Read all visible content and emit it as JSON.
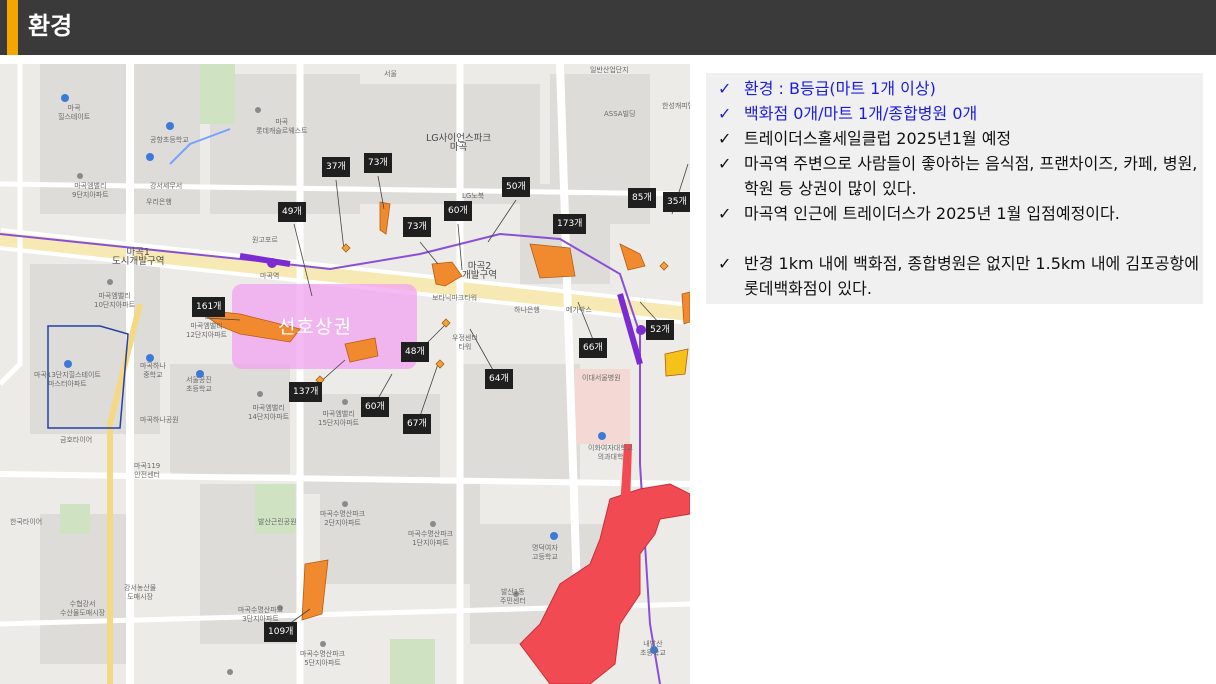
{
  "header": {
    "title": "환경",
    "accent_color": "#f5a500",
    "bar_color": "#3a3a3a"
  },
  "map": {
    "zone_label": "선호상권",
    "counts": {
      "c37": "37개",
      "c73a": "73개",
      "c49": "49개",
      "c60a": "60개",
      "c73b": "73개",
      "c50": "50개",
      "c173": "173개",
      "c85": "85개",
      "c35": "35개",
      "c161": "161개",
      "c48": "48개",
      "c52": "52개",
      "c66": "66개",
      "c137": "137개",
      "c60b": "60개",
      "c64": "64개",
      "c67": "67개",
      "c109": "109개"
    },
    "labels": {
      "ilsan": "일반산업단지",
      "seoul": "서울",
      "mg_hills": "마곡\n힐스테이트",
      "lotte_castle": "마곡\n롯데캐슬르웨스트",
      "lg_science": "LG사이언스파크\n마곡",
      "gonghang_school": "공항초등학교",
      "mg_valley9": "마곡엠밸리\n9단지아파트",
      "gangseo_tax": "강서세무서",
      "woori_bank": "우리은행",
      "woonji_school": "원고포르",
      "magok1": "마곡1\n도시개발구역",
      "mg_valley10": "마곡엠밸리\n10단지아파트",
      "magok2": "마곡2\n개발구역",
      "botanic": "보타닉파크타워",
      "hana_bank": "하나은행",
      "megabox": "메가박스",
      "ewha_hosp": "이대서울병원",
      "mg_valley12": "마곡엠밸리\n12단지아파트",
      "magok_stn": "마곡역",
      "mg13": "마곡13단지힐스테이트\n마스터아파트",
      "mg_middle": "마곡하나\n중학교",
      "seoul_gongjin": "서울공진\n초등학교",
      "mg_valley14": "마곡엠밸리\n14단지아파트",
      "mg_valley15": "마곡엠밸리\n15단지아파트",
      "mg_park": "마곡하나공원",
      "kumho_tire": "금호타이어",
      "mg119": "마곡119\n안전센터",
      "ewha_univ": "이화여자대학교\n의과대학",
      "balsan_park": "발산근린공원",
      "mg_sujeong2": "마곡수명산파크\n2단지아파트",
      "mg_sujeong1": "마곡수명산파크\n1단지아파트",
      "hankook_tire": "한국타이어",
      "myungduk_hs": "명덕여자\n고등학교",
      "gangseo_market": "강서농산물\n도매시장",
      "suhyup": "수협강서\n수산물도매시장",
      "mg_sujeong3": "마곡수명산파크\n3단지아파트",
      "mg_sujeong5": "마곡수명산파크\n5단지아파트",
      "balsan1": "발산1동\n주민센터",
      "naebalsan": "내발산\n초등학교",
      "ubang": "우정센터\n타워",
      "lgnorth": "LG노북",
      "assa": "ASSA빌딩",
      "hansung": "한성캐피탈"
    }
  },
  "checklist": [
    {
      "mark": "✓",
      "text": "환경 : B등급(마트 1개 이상)",
      "color": "#1c1ce0"
    },
    {
      "mark": "✓",
      "text": "백화점 0개/마트 1개/종합병원 0개",
      "color": "#1c1ce0"
    },
    {
      "mark": "✓",
      "text": "트레이더스홀세일클럽 2025년1월 예정",
      "color": "#111111"
    },
    {
      "mark": "✓",
      "text": "마곡역 주변으로 사람들이 좋아하는 음식점, 프랜차이즈, 카페, 병원, 학원 등 상권이 많이 있다.",
      "color": "#111111"
    },
    {
      "mark": "✓",
      "text": "마곡역 인근에 트레이더스가 2025년 1월 입점예정이다.",
      "color": "#111111"
    },
    {
      "mark": "✓",
      "text": "반경 1km 내에 백화점, 종합병원은 없지만 1.5km 내에 김포공항에 롯데백화점이 있다.",
      "color": "#111111"
    }
  ]
}
